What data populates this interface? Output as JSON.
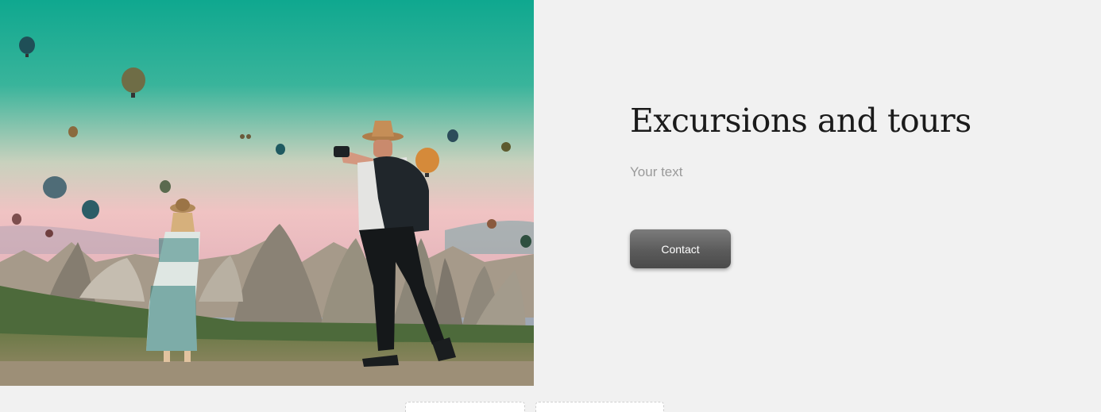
{
  "hero": {
    "image_name": "travel-couple-hot-air-balloons-photo"
  },
  "main": {
    "title": "Excursions and tours",
    "subtitle": "Your text",
    "contact_label": "Contact"
  },
  "colors": {
    "page_background": "#f1f1f1",
    "title": "#1b1b1b",
    "subtitle": "#9a9a9a",
    "button_top": "#7b7b7b",
    "button_bottom": "#4a4a4a",
    "button_text": "#ffffff"
  }
}
